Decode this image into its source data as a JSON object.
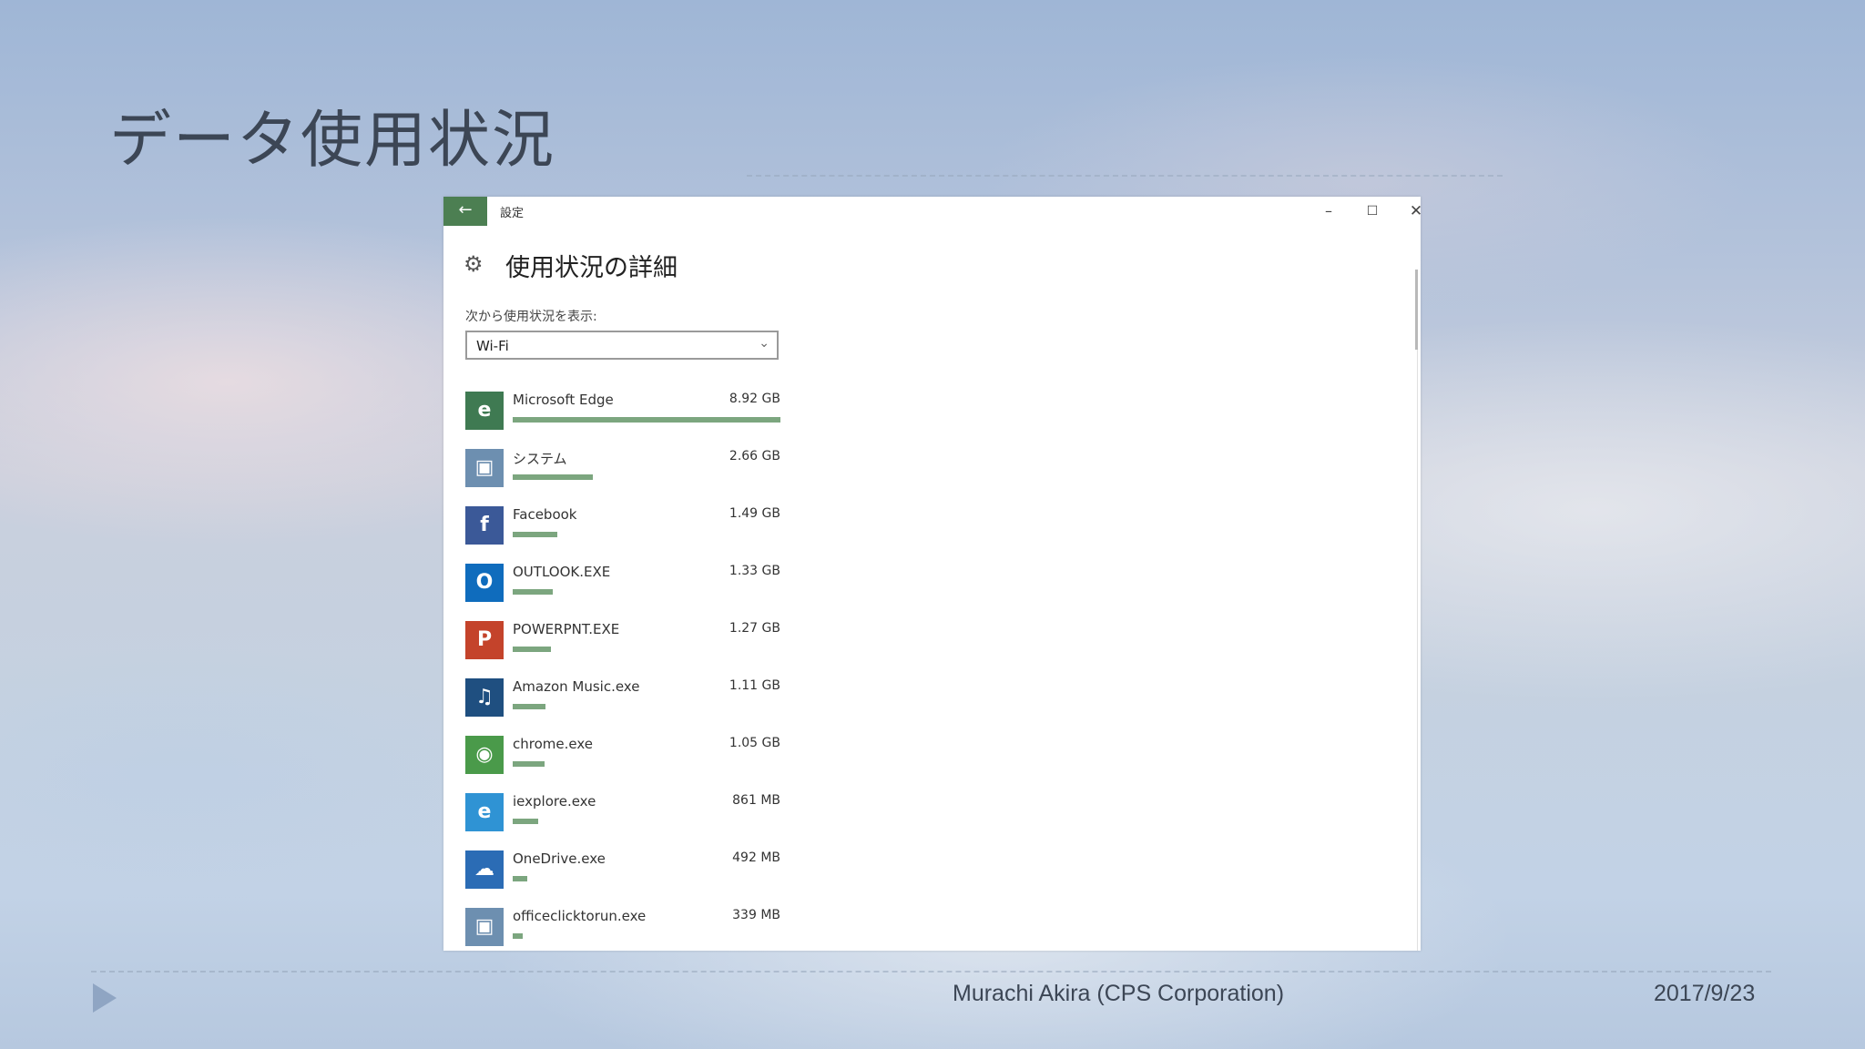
{
  "slide": {
    "title": "データ使用状況",
    "footer_author": "Murachi Akira (CPS Corporation)",
    "footer_date": "2017/9/23"
  },
  "window": {
    "back_label": "←",
    "title": "設定",
    "minimize_glyph": "–",
    "maximize_glyph": "☐",
    "close_glyph": "✕"
  },
  "page": {
    "gear_glyph": "⚙",
    "heading": "使用状況の詳細",
    "show_label": "次から使用状況を表示:",
    "dropdown_value": "Wi-Fi",
    "dropdown_chevron": "⌄"
  },
  "colors": {
    "accent": "#4c7f52",
    "bar": "#7ca67f"
  },
  "apps": [
    {
      "name": "Microsoft Edge",
      "size": "8.92 GB",
      "share": 1.0,
      "icon": "edge-icon",
      "glyph": "e",
      "color": "#3f7a52"
    },
    {
      "name": "システム",
      "size": "2.66 GB",
      "share": 0.298,
      "icon": "system-icon",
      "glyph": "▣",
      "color": "#6d8fb0"
    },
    {
      "name": "Facebook",
      "size": "1.49 GB",
      "share": 0.167,
      "icon": "facebook-icon",
      "glyph": "f",
      "color": "#3b5998"
    },
    {
      "name": "OUTLOOK.EXE",
      "size": "1.33 GB",
      "share": 0.149,
      "icon": "outlook-icon",
      "glyph": "O",
      "color": "#0f6cbd"
    },
    {
      "name": "POWERPNT.EXE",
      "size": "1.27 GB",
      "share": 0.142,
      "icon": "powerpoint-icon",
      "glyph": "P",
      "color": "#c4432b"
    },
    {
      "name": "Amazon Music.exe",
      "size": "1.11 GB",
      "share": 0.124,
      "icon": "amazon-music-icon",
      "glyph": "♫",
      "color": "#1f4f80"
    },
    {
      "name": "chrome.exe",
      "size": "1.05 GB",
      "share": 0.118,
      "icon": "chrome-icon",
      "glyph": "◉",
      "color": "#4a9a4a"
    },
    {
      "name": "iexplore.exe",
      "size": "861 MB",
      "share": 0.094,
      "icon": "internet-explorer-icon",
      "glyph": "e",
      "color": "#2f93d4"
    },
    {
      "name": "OneDrive.exe",
      "size": "492 MB",
      "share": 0.054,
      "icon": "onedrive-icon",
      "glyph": "☁",
      "color": "#2b6cb5"
    },
    {
      "name": "officeclicktorun.exe",
      "size": "339 MB",
      "share": 0.037,
      "icon": "office-icon",
      "glyph": "▣",
      "color": "#6d8fb0"
    }
  ]
}
